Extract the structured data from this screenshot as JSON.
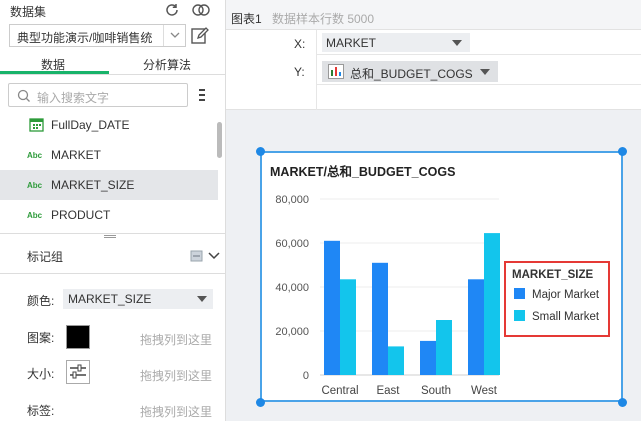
{
  "dataset": {
    "title": "数据集",
    "selected": "典型功能演示/咖啡销售统",
    "icons": {
      "refresh": "refresh-icon",
      "link": "link-icon",
      "edit": "edit-icon"
    }
  },
  "tabs": [
    {
      "label": "数据"
    },
    {
      "label": "分析算法"
    }
  ],
  "search": {
    "placeholder": "输入搜索文字"
  },
  "fields": [
    {
      "type": "",
      "name": "FullDay_DATE"
    },
    {
      "type": "Abc",
      "name": "MARKET"
    },
    {
      "type": "Abc",
      "name": "MARKET_SIZE"
    },
    {
      "type": "Abc",
      "name": "PRODUCT"
    }
  ],
  "marks": {
    "title": "标记组",
    "color_label": "颜色:",
    "color_value": "MARKET_SIZE",
    "pattern_label": "图案:",
    "size_label": "大小:",
    "tag_label": "标签:",
    "drop_hint": "拖拽列到这里"
  },
  "header": {
    "chart_name": "图表1",
    "sample_count": "数据样本行数 5000"
  },
  "axes": {
    "x_label": "X:",
    "x_value": "MARKET",
    "y_label": "Y:",
    "y_value": "总和_BUDGET_COGS"
  },
  "colors": {
    "major": "#1f87f5",
    "small": "#13c5ec",
    "legend_border": "#e53935",
    "selection": "#4aa3e8"
  },
  "chart_data": {
    "type": "bar",
    "title": "MARKET/总和_BUDGET_COGS",
    "categories": [
      "Central",
      "East",
      "South",
      "West"
    ],
    "series": [
      {
        "name": "Major Market",
        "values": [
          61000,
          51000,
          15500,
          43500
        ]
      },
      {
        "name": "Small Market",
        "values": [
          43500,
          13000,
          25000,
          64500
        ]
      }
    ],
    "yticks": [
      "0",
      "20,000",
      "40,000",
      "60,000",
      "80,000"
    ],
    "ylim": [
      0,
      80000
    ],
    "legend_title": "MARKET_SIZE",
    "legend_position": "right",
    "grid": true
  }
}
